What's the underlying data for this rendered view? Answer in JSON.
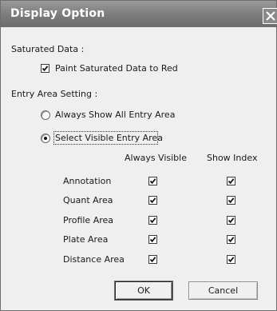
{
  "window": {
    "title": "Display Option",
    "close_icon": "close-icon"
  },
  "saturated": {
    "heading": "Saturated Data :",
    "paint_label": "Paint Saturated Data to Red",
    "paint_checked": true
  },
  "entry_area": {
    "heading": "Entry Area Setting :",
    "options": [
      {
        "label": "Always Show All Entry Area",
        "selected": false
      },
      {
        "label": "Select Visible Entry Area",
        "selected": true
      }
    ]
  },
  "table": {
    "columns": [
      "Always Visible",
      "Show Index"
    ],
    "rows": [
      {
        "label": "Annotation",
        "always_visible": true,
        "show_index": true
      },
      {
        "label": "Quant Area",
        "always_visible": true,
        "show_index": true
      },
      {
        "label": "Profile Area",
        "always_visible": true,
        "show_index": true
      },
      {
        "label": "Plate Area",
        "always_visible": true,
        "show_index": true
      },
      {
        "label": "Distance Area",
        "always_visible": true,
        "show_index": true
      }
    ]
  },
  "buttons": {
    "ok": "OK",
    "cancel": "Cancel"
  }
}
